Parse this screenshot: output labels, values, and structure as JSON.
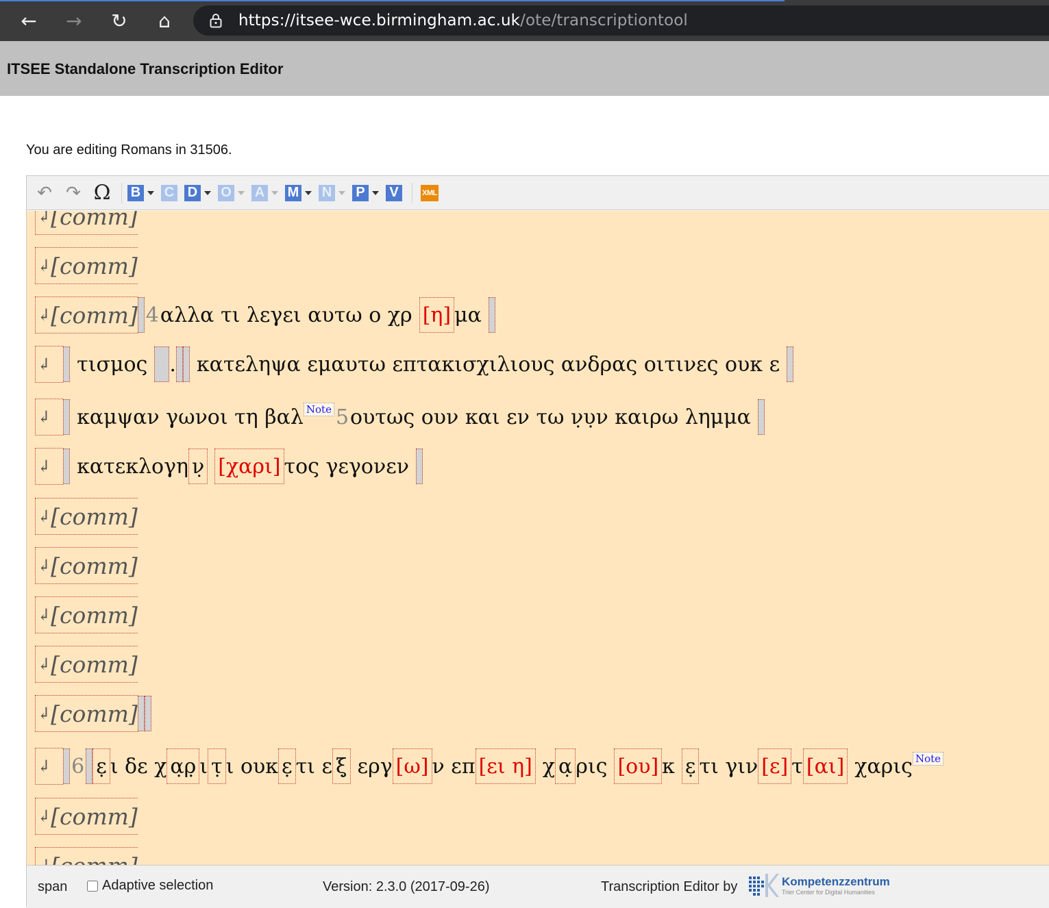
{
  "browser": {
    "url_host": "https://itsee-wce.birmingham.ac.uk",
    "url_path": "/ote/transcriptiontool",
    "back_icon": "←",
    "forward_icon": "→",
    "reload_icon": "↻",
    "home_icon": "⌂"
  },
  "app": {
    "title": "ITSEE Standalone Transcription Editor"
  },
  "editing_text": "You are editing Romans in 31506.",
  "toolbar": {
    "undo": "↶",
    "redo": "↷",
    "omega": "Ω",
    "letters": [
      "B",
      "C",
      "D",
      "O",
      "A",
      "M",
      "N",
      "P",
      "V"
    ],
    "xml": "XML"
  },
  "content": {
    "cr_glyph": "↲",
    "comm": "[comm]",
    "line3": {
      "num": "4",
      "a": "αλλα τι λεγει αυτω ο χρ",
      "supp": "[η]",
      "b": "μα"
    },
    "line4": {
      "a": "τισμος",
      "dot": ".",
      "b": "κατεληψα εμαυτω επτακισχιλιους ανδρας οιτινες ουκ ε"
    },
    "line5": {
      "a": "καμψαν γωνοι τη βαλ",
      "note": "Note",
      "num": "5",
      "b": "ουτως ουν και εν τω ν̣υ̣ν καιρω λημμα"
    },
    "line6": {
      "a": "κατεκλογη",
      "unc": "ν̣",
      "supp": "[χαρι]",
      "b": "τος γεγονεν"
    },
    "line12": {
      "num": "6",
      "e1": "ε̣",
      "t1": "ι δε χ",
      "ar": "α̣ρ̣",
      "t2": "ι",
      "tau": "τ̣",
      "t3": "ι ουκ",
      "e2": "ε̣",
      "t4": "τι ε",
      "xi": "ξ̣",
      "t5": "εργ",
      "s1": "[ω]",
      "t6": "ν επ",
      "s2": "[ει η]",
      "t7": "χ",
      "a2": "α̣",
      "t8": "ρις",
      "s3": "[ου]",
      "t9": "κ",
      "e3": "ε̣",
      "t10": "τι γιν",
      "s4": "[ε]",
      "t11": "τ",
      "s5": "[αι]",
      "t12": "χαρις",
      "note": "Note"
    }
  },
  "status": {
    "span": "span",
    "adaptive": "Adaptive selection",
    "version": "Version: 2.3.0 (2017-09-26)",
    "by": "Transcription Editor by",
    "logo_title": "Kompetenzzentrum",
    "logo_sub": "Trier Center for Digital Humanities"
  }
}
